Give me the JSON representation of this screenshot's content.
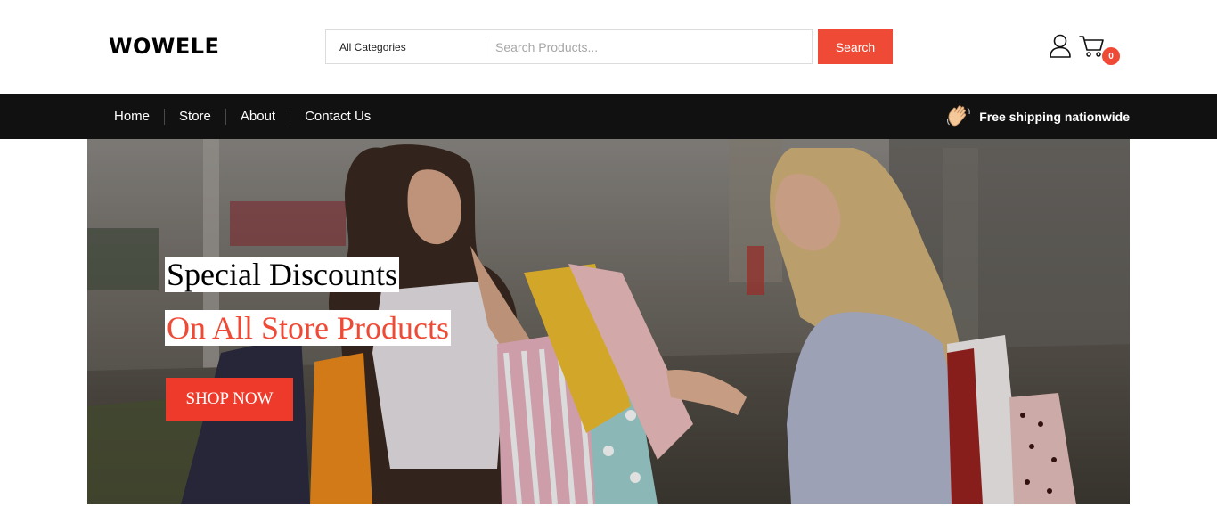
{
  "header": {
    "logo": "WOWELE",
    "search": {
      "category_label": "All Categories",
      "placeholder": "Search Products...",
      "button_label": "Search"
    },
    "user_icon": "user-icon",
    "cart_icon": "cart-icon",
    "cart_count": "0"
  },
  "nav": {
    "items": [
      "Home",
      "Store",
      "About",
      "Contact Us"
    ],
    "shipping_text": "Free shipping nationwide",
    "shipping_icon": "waving-hand-icon"
  },
  "hero": {
    "title": "Special Discounts",
    "subtitle": "On All Store Products",
    "cta_label": "SHOP NOW"
  },
  "colors": {
    "accent": "#ee4a36",
    "navbar_bg": "#111111",
    "text_dark": "#000000"
  }
}
